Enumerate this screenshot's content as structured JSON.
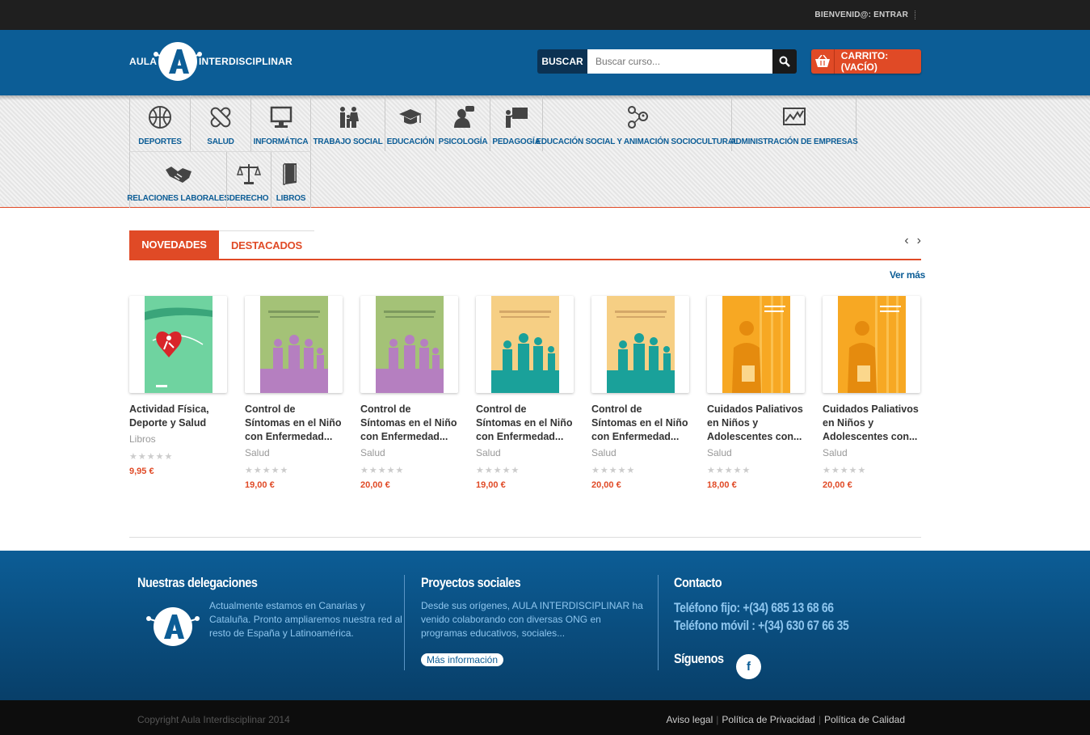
{
  "topbar": {
    "welcome": "BIENVENID@: ENTRAR"
  },
  "brand": {
    "left": "AULA",
    "right": "INTERDISCIPLINAR"
  },
  "search": {
    "label": "BUSCAR",
    "placeholder": "Buscar curso..."
  },
  "cart": {
    "label": "CARRITO:(VACÍO)"
  },
  "categories_row1": [
    {
      "label": "DEPORTES",
      "icon": "basketball-icon"
    },
    {
      "label": "SALUD",
      "icon": "bandage-icon"
    },
    {
      "label": "INFORMÁTICA",
      "icon": "monitor-icon"
    },
    {
      "label": "TRABAJO SOCIAL",
      "icon": "people-icon"
    },
    {
      "label": "EDUCACIÓN",
      "icon": "graduation-cap-icon"
    },
    {
      "label": "PSICOLOGÍA",
      "icon": "head-speech-icon"
    },
    {
      "label": "PEDAGOGÍA",
      "icon": "teacher-board-icon"
    },
    {
      "label": "EDUCACIÓN SOCIAL Y ANIMACIÓN SOCIOCULTURAL",
      "icon": "network-people-icon"
    },
    {
      "label": "ADMINISTRACIÓN DE EMPRESAS",
      "icon": "chart-icon"
    }
  ],
  "categories_row2": [
    {
      "label": "RELACIONES LABORALES",
      "icon": "handshake-icon"
    },
    {
      "label": "DERECHO",
      "icon": "scales-icon"
    },
    {
      "label": "LIBROS",
      "icon": "book-icon"
    }
  ],
  "tabs": {
    "active": "NOVEDADES",
    "inactive": "DESTACADOS"
  },
  "carousel": {
    "prev": "‹",
    "next": "›"
  },
  "see_more": "Ver más",
  "products": [
    {
      "name": "Actividad Física, Deporte y Salud",
      "category": "Libros",
      "price": "9,95 €",
      "stars": "★★★★★",
      "cover": "green"
    },
    {
      "name": "Control de Síntomas en el Niño con Enfermedad...",
      "category": "Salud",
      "price": "19,00 €",
      "stars": "★★★★★",
      "cover": "purple"
    },
    {
      "name": "Control de Síntomas en el Niño con Enfermedad...",
      "category": "Salud",
      "price": "20,00 €",
      "stars": "★★★★★",
      "cover": "purple"
    },
    {
      "name": "Control de Síntomas en el Niño con Enfermedad...",
      "category": "Salud",
      "price": "19,00 €",
      "stars": "★★★★★",
      "cover": "teal"
    },
    {
      "name": "Control de Síntomas en el Niño con Enfermedad...",
      "category": "Salud",
      "price": "20,00 €",
      "stars": "★★★★★",
      "cover": "teal"
    },
    {
      "name": "Cuidados Paliativos en Niños y Adolescentes con...",
      "category": "Salud",
      "price": "18,00 €",
      "stars": "★★★★★",
      "cover": "orange"
    },
    {
      "name": "Cuidados Paliativos en Niños y Adolescentes con...",
      "category": "Salud",
      "price": "20,00 €",
      "stars": "★★★★★",
      "cover": "orange"
    }
  ],
  "footer": {
    "delegaciones": {
      "title": "Nuestras delegaciones",
      "text": "Actualmente estamos en Canarias y Cataluña. Pronto ampliaremos nuestra red al resto de España y Latinoamérica."
    },
    "proyectos": {
      "title": "Proyectos sociales",
      "text": "Desde sus orígenes, AULA INTERDISCIPLINAR ha venido colaborando con diversas ONG en programas educativos, sociales...",
      "button": "Más información"
    },
    "contacto": {
      "title": "Contacto",
      "phone_fixed": "Teléfono fijo: +(34) 685 13 68 66",
      "phone_mobile": "Teléfono móvil : +(34) 630 67 66 35",
      "follow": "Síguenos",
      "facebook": "f"
    }
  },
  "bottom": {
    "copyright": "Copyright Aula Interdisciplinar 2014",
    "links": [
      "Aviso legal",
      "Política de Privacidad",
      "Política de Calidad"
    ]
  },
  "colors": {
    "brand_blue": "#0c5d96",
    "accent_orange": "#e04a26",
    "dark": "#1f1f1f"
  }
}
